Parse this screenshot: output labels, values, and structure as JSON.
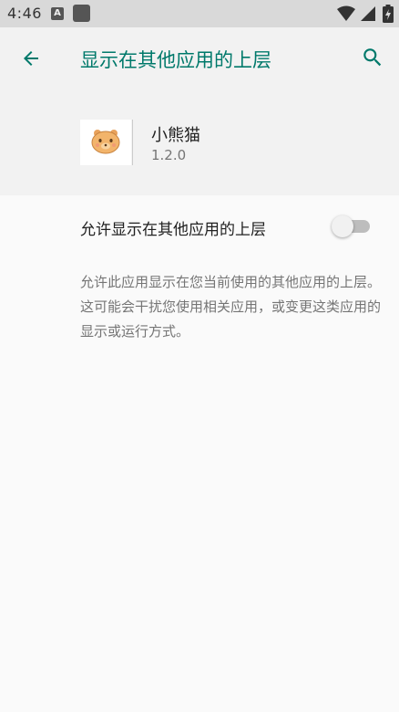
{
  "status_bar": {
    "time": "4:46",
    "notification_a_letter": "A"
  },
  "app_bar": {
    "title": "显示在其他应用的上层"
  },
  "app_info": {
    "name": "小熊猫",
    "version": "1.2.0"
  },
  "setting": {
    "label": "允许显示在其他应用的上层",
    "enabled": false,
    "summary": "允许此应用显示在您当前使用的其他应用的上层。这可能会干扰您使用相关应用，或变更这类应用的显示或运行方式。"
  },
  "colors": {
    "accent": "#00796b",
    "status_bar_bg": "#d9d9d9",
    "header_bg": "#f2f2f2",
    "page_bg": "#fafafa"
  },
  "icons": [
    "back-arrow",
    "search",
    "wifi",
    "signal",
    "battery",
    "app-icon-bear-face"
  ]
}
